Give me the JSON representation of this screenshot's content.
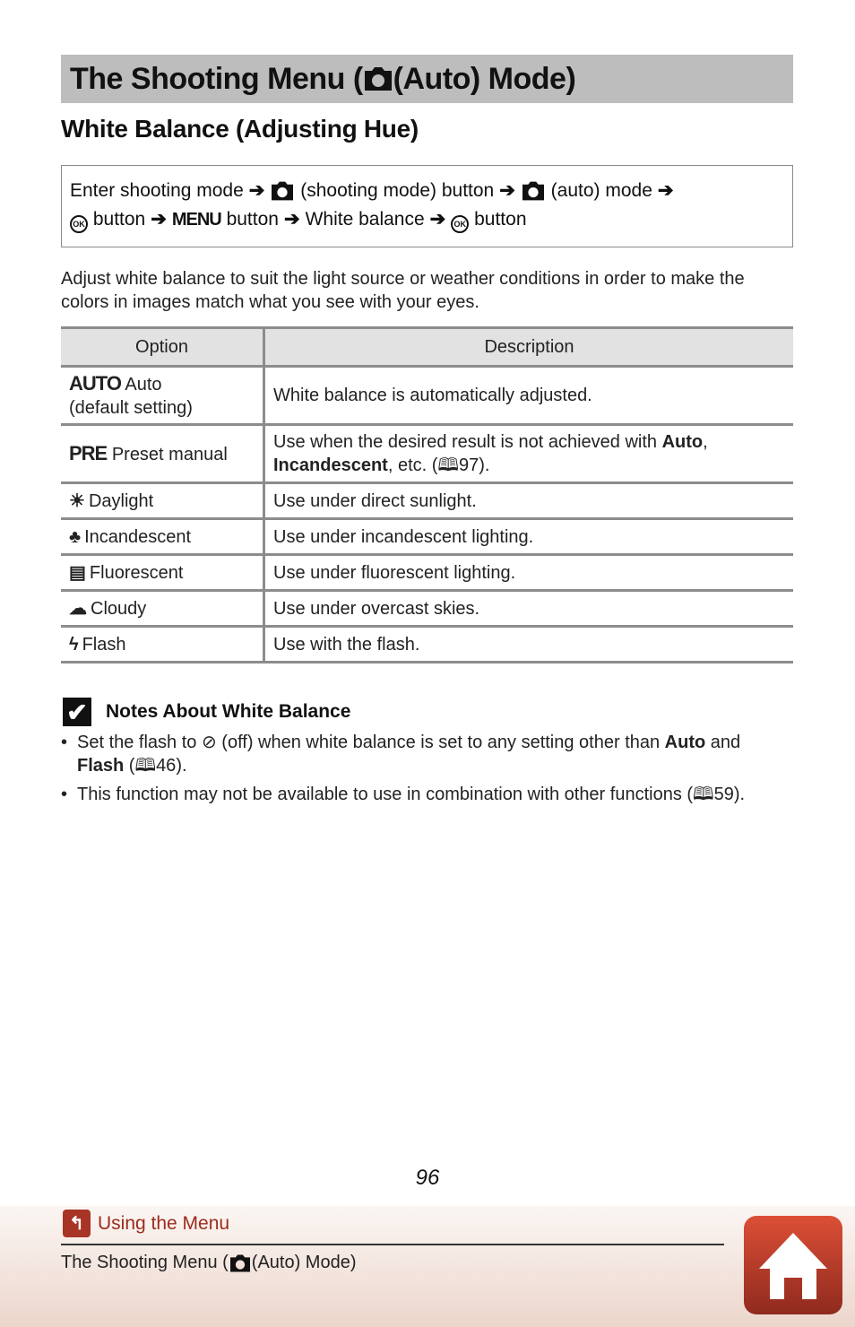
{
  "header": {
    "title_prefix": "The Shooting Menu (",
    "title_suffix": " (Auto) Mode)",
    "title_icon": "camera-icon"
  },
  "section": {
    "title": "White Balance (Adjusting Hue)"
  },
  "nav_path": {
    "part1": "Enter shooting mode",
    "part2": "(shooting mode) button",
    "part3": "(auto) mode",
    "part4": "button",
    "menu_label": "MENU",
    "part5": "button",
    "part6": "White balance",
    "part7": "button",
    "ok_label": "OK",
    "arrow": "➔"
  },
  "intro": "Adjust white balance to suit the light source or weather conditions in order to make the colors in images match what you see with your eyes.",
  "table": {
    "headers": [
      "Option",
      "Description"
    ],
    "rows": [
      {
        "icon": "AUTO",
        "icon_name": "auto-icon",
        "option": "Auto",
        "option_note": "(default setting)",
        "description": "White balance is automatically adjusted."
      },
      {
        "icon": "PRE",
        "icon_name": "preset-icon",
        "option": "Preset manual",
        "desc_pre": "Use when the desired result is not achieved with ",
        "desc_b1": "Auto",
        "desc_mid": ", ",
        "desc_b2": "Incandescent",
        "desc_post": ", etc. (",
        "desc_ref": "97",
        "desc_end": ")."
      },
      {
        "icon": "☀",
        "icon_name": "daylight-icon",
        "option": "Daylight",
        "description": "Use under direct sunlight."
      },
      {
        "icon": "♣",
        "icon_name": "incandescent-icon",
        "option": "Incandescent",
        "description": "Use under incandescent lighting."
      },
      {
        "icon": "▤",
        "icon_name": "fluorescent-icon",
        "option": "Fluorescent",
        "description": "Use under fluorescent lighting."
      },
      {
        "icon": "☁",
        "icon_name": "cloudy-icon",
        "option": "Cloudy",
        "description": "Use under overcast skies."
      },
      {
        "icon": "ϟ",
        "icon_name": "flash-icon",
        "option": "Flash",
        "description": "Use with the flash."
      }
    ]
  },
  "notes": {
    "check": "✔",
    "title": "Notes About White Balance",
    "item1": {
      "pre": "Set the flash to ",
      "icon": "⊘",
      "mid": " (off) when white balance is set to any setting other than ",
      "b1": "Auto",
      "and": " and ",
      "b2": "Flash",
      "post": " (",
      "ref": "46",
      "end": ")."
    },
    "item2": {
      "pre": "This function may not be available to use in combination with other functions (",
      "ref": "59",
      "end": ")."
    }
  },
  "book_glyph": "🕮",
  "page_number": "96",
  "footer": {
    "back_link": "Using the Menu",
    "back_icon": "↰",
    "crumb_prefix": "The Shooting Menu (",
    "crumb_suffix": " (Auto) Mode)"
  },
  "colors": {
    "title_bar": "#bdbdbd",
    "accent": "#a83426",
    "footer_bg": "#ecd6cc"
  }
}
